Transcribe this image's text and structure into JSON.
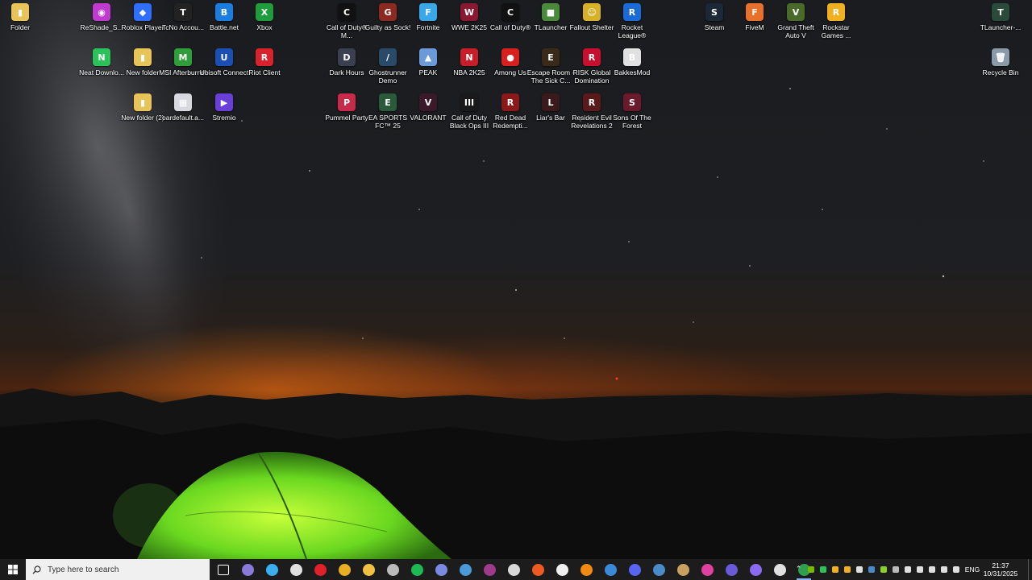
{
  "desktop_icons": [
    {
      "label": "Folder",
      "glyph": "▮",
      "color": "#e8c35a",
      "icon": "folder-icon"
    },
    {
      "label": "ReShade_S...",
      "glyph": "◉",
      "color": "#c03ad0",
      "icon": "reshade-icon"
    },
    {
      "label": "Roblox Player",
      "glyph": "◆",
      "color": "#2f6fff",
      "icon": "roblox-icon"
    },
    {
      "label": "TcNo Accou...",
      "glyph": "T",
      "color": "#222222",
      "icon": "tcno-icon"
    },
    {
      "label": "Battle.net",
      "glyph": "B",
      "color": "#1a7de0",
      "icon": "battlenet-icon"
    },
    {
      "label": "Xbox",
      "glyph": "X",
      "color": "#1f9c3c",
      "icon": "xbox-icon"
    },
    {
      "label": "Neat Downlo...",
      "glyph": "N",
      "color": "#2cc25a",
      "icon": "neat-download-icon"
    },
    {
      "label": "New folder",
      "glyph": "▮",
      "color": "#e8c35a",
      "icon": "folder-icon"
    },
    {
      "label": "MSI Afterburner",
      "glyph": "M",
      "color": "#2e9d3a",
      "icon": "msi-afterburner-icon"
    },
    {
      "label": "Ubisoft Connect",
      "glyph": "U",
      "color": "#1b4fb4",
      "icon": "ubisoft-icon"
    },
    {
      "label": "Riot Client",
      "glyph": "R",
      "color": "#d8222e",
      "icon": "riot-icon"
    },
    {
      "label": "New folder (2)",
      "glyph": "▮",
      "color": "#e8c35a",
      "icon": "folder-icon"
    },
    {
      "label": "oardefault.a...",
      "glyph": "▦",
      "color": "#d8d8e0",
      "icon": "file-icon"
    },
    {
      "label": "Stremio",
      "glyph": "▶",
      "color": "#6a3fd8",
      "icon": "stremio-icon"
    },
    {
      "label": "Call of Duty® M...",
      "glyph": "C",
      "color": "#111111",
      "icon": "cod-icon"
    },
    {
      "label": "Guilty as Sock!",
      "glyph": "G",
      "color": "#8a2a20",
      "icon": "guilty-as-sock-icon"
    },
    {
      "label": "Fortnite",
      "glyph": "F",
      "color": "#3aa8e8",
      "icon": "fortnite-icon"
    },
    {
      "label": "WWE 2K25",
      "glyph": "W",
      "color": "#8a1830",
      "icon": "wwe-icon"
    },
    {
      "label": "Call of Duty®",
      "glyph": "C",
      "color": "#111111",
      "icon": "cod-icon"
    },
    {
      "label": "TLauncher",
      "glyph": "■",
      "color": "#4a8a3a",
      "icon": "tlauncher-icon"
    },
    {
      "label": "Fallout Shelter",
      "glyph": "☺",
      "color": "#d8b02a",
      "icon": "fallout-shelter-icon"
    },
    {
      "label": "Rocket League®",
      "glyph": "R",
      "color": "#1a6ad8",
      "icon": "rocket-league-icon"
    },
    {
      "label": "Dark Hours",
      "glyph": "D",
      "color": "#3a4050",
      "icon": "dark-hours-icon"
    },
    {
      "label": "Ghostrunner Demo",
      "glyph": "/",
      "color": "#2a4a6a",
      "icon": "ghostrunner-icon"
    },
    {
      "label": "PEAK",
      "glyph": "▲",
      "color": "#6a9ad8",
      "icon": "peak-icon"
    },
    {
      "label": "NBA 2K25",
      "glyph": "N",
      "color": "#c81e2a",
      "icon": "nba-icon"
    },
    {
      "label": "Among Us",
      "glyph": "●",
      "color": "#d82020",
      "icon": "among-us-icon"
    },
    {
      "label": "Escape Room - The Sick C...",
      "glyph": "E",
      "color": "#3a2a1a",
      "icon": "escape-room-icon"
    },
    {
      "label": "RISK Global Domination",
      "glyph": "R",
      "color": "#c8102e",
      "icon": "risk-icon"
    },
    {
      "label": "BakkesMod",
      "glyph": "B",
      "color": "#e0e0e0",
      "icon": "bakkesmod-icon"
    },
    {
      "label": "Pummel Party",
      "glyph": "P",
      "color": "#c82a4a",
      "icon": "pummel-party-icon"
    },
    {
      "label": "EA SPORTS FC™ 25",
      "glyph": "E",
      "color": "#2a5a3a",
      "icon": "ea-fc-icon"
    },
    {
      "label": "VALORANT",
      "glyph": "V",
      "color": "#3a1a2a",
      "icon": "valorant-icon"
    },
    {
      "label": "Call of Duty Black Ops III",
      "glyph": "III",
      "color": "#1a1a1a",
      "icon": "black-ops-icon"
    },
    {
      "label": "Red Dead Redempti...",
      "glyph": "R",
      "color": "#8a1a1a",
      "icon": "red-dead-icon"
    },
    {
      "label": "Liar's Bar",
      "glyph": "L",
      "color": "#3a1a1a",
      "icon": "liars-bar-icon"
    },
    {
      "label": "Resident Evil Revelations 2",
      "glyph": "R",
      "color": "#5a1a1a",
      "icon": "resident-evil-icon"
    },
    {
      "label": "Sons Of The Forest",
      "glyph": "S",
      "color": "#6a1a2a",
      "icon": "sons-of-the-forest-icon"
    },
    {
      "label": "Steam",
      "glyph": "S",
      "color": "#1b2838",
      "icon": "steam-icon"
    },
    {
      "label": "FiveM",
      "glyph": "F",
      "color": "#e8702a",
      "icon": "fivem-icon"
    },
    {
      "label": "Grand Theft Auto V",
      "glyph": "V",
      "color": "#4a6a2a",
      "icon": "gta-icon"
    },
    {
      "label": "Rockstar Games ...",
      "glyph": "R",
      "color": "#f0b020",
      "icon": "rockstar-icon"
    },
    {
      "label": "TLauncher-...",
      "glyph": "T",
      "color": "#2a4a3a",
      "icon": "tlauncher-icon"
    },
    {
      "label": "Recycle Bin",
      "glyph": "🗑",
      "color": "#8a9aa8",
      "icon": "recycle-bin-icon"
    }
  ],
  "taskbar": {
    "search_placeholder": "Type here to search",
    "apps": [
      {
        "icon": "task-view-icon",
        "color": "#ffffff"
      },
      {
        "icon": "game-controller-icon",
        "color": "#8a7ad8"
      },
      {
        "icon": "copilot-icon",
        "color": "#3ab0f0"
      },
      {
        "icon": "steelseries-icon",
        "color": "#e0e0e0"
      },
      {
        "icon": "opera-icon",
        "color": "#e0202a"
      },
      {
        "icon": "chrome-icon",
        "color": "#e8b020"
      },
      {
        "icon": "file-explorer-icon",
        "color": "#f0c040"
      },
      {
        "icon": "obs-icon",
        "color": "#bbbbbb"
      },
      {
        "icon": "spotify-icon",
        "color": "#1db954"
      },
      {
        "icon": "discord-alt-icon",
        "color": "#7a8ae0"
      },
      {
        "icon": "window-icon",
        "color": "#4a9ad8"
      },
      {
        "icon": "winrar-icon",
        "color": "#a03a8a"
      },
      {
        "icon": "ubisoft-icon",
        "color": "#d8d8d8"
      },
      {
        "icon": "brave-icon",
        "color": "#f05a20"
      },
      {
        "icon": "g-app-icon",
        "color": "#f0f0f0"
      },
      {
        "icon": "vlc-icon",
        "color": "#f08a10"
      },
      {
        "icon": "qbittorrent-icon",
        "color": "#3a8ad8"
      },
      {
        "icon": "discord-icon",
        "color": "#5865f2"
      },
      {
        "icon": "steam-icon",
        "color": "#4a8ac8"
      },
      {
        "icon": "game-app-icon",
        "color": "#c8a060"
      },
      {
        "icon": "pen-icon",
        "color": "#e040a0"
      },
      {
        "icon": "controller-icon",
        "color": "#6a5ad8"
      },
      {
        "icon": "play-icon",
        "color": "#8a6af0"
      },
      {
        "icon": "g-hub-icon",
        "color": "#e0e0e0"
      },
      {
        "icon": "chrome-active-icon",
        "color": "#30a050"
      }
    ],
    "tray": [
      {
        "icon": "nvidia-icon",
        "color": "#76b900"
      },
      {
        "icon": "green-dot-icon",
        "color": "#2cc25a"
      },
      {
        "icon": "rockstar-tray-icon",
        "color": "#f0b020"
      },
      {
        "icon": "r-tray-icon",
        "color": "#f0b020"
      },
      {
        "icon": "mic-icon",
        "color": "#e0e0e0"
      },
      {
        "icon": "steam-tray-icon",
        "color": "#4a8ac8"
      },
      {
        "icon": "nvidia-share-icon",
        "color": "#8ad02a"
      },
      {
        "icon": "chrome-tray-icon",
        "color": "#bbbbbb"
      },
      {
        "icon": "brightness-icon",
        "color": "#e0e0e0"
      },
      {
        "icon": "speaker-icon",
        "color": "#e0e0e0"
      },
      {
        "icon": "volume-icon",
        "color": "#e0e0e0"
      },
      {
        "icon": "network-icon",
        "color": "#e0e0e0"
      },
      {
        "icon": "battery-icon",
        "color": "#e0e0e0"
      }
    ],
    "language": "ENG",
    "time": "21:37",
    "date": "10/31/2025"
  }
}
